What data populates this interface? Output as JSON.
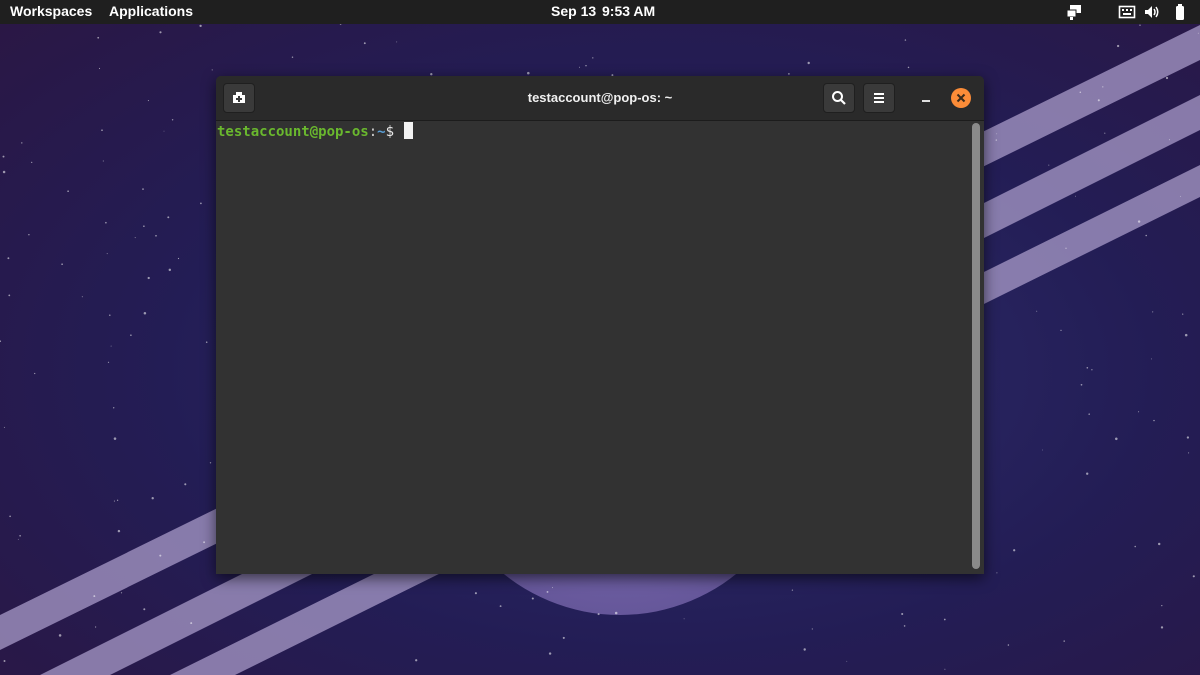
{
  "top_panel": {
    "workspaces_label": "Workspaces",
    "applications_label": "Applications",
    "date": "Sep 13",
    "time": "9:53 AM",
    "tray_icons": [
      "network-icon",
      "keyboard-icon",
      "volume-icon",
      "battery-icon"
    ]
  },
  "terminal": {
    "title": "testaccount@pop-os: ~",
    "prompt": {
      "user_host": "testaccount@pop-os",
      "separator": ":",
      "path": "~",
      "symbol": "$ "
    },
    "header_icons": [
      "new-tab-icon",
      "search-icon",
      "hamburger-menu-icon",
      "minimize-icon",
      "close-icon"
    ]
  },
  "colors": {
    "panel_bg": "#1f1f1f",
    "terminal_bg": "#323232",
    "prompt_user": "#6ab82e",
    "prompt_path": "#5a9fd6",
    "close_accent": "#fb8c38"
  }
}
